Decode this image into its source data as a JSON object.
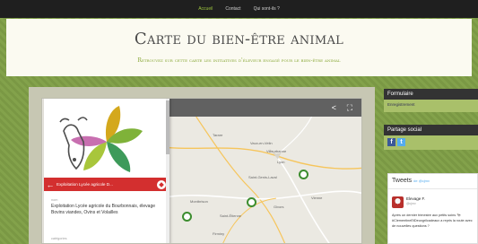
{
  "nav": {
    "items": [
      "Accueil",
      "Contact",
      "Qui sont-ils ?"
    ]
  },
  "header": {
    "title": "Carte du bien-être animal",
    "subtitle": "Retrouvez sur cette carte les initiatives d'éleveur engagé pour le bien-être animal"
  },
  "map": {
    "towns": [
      "Tarare",
      "Vaux-en-Velin",
      "Villeurbanne",
      "Lyon",
      "Saint-Genis-Laval",
      "Vienne",
      "Montbrison",
      "Saint-Étienne",
      "Givors",
      "Firminy"
    ],
    "panel": {
      "header_title": "Exploitation Lycée agricole D...",
      "field_label": "nom",
      "field_value": "Exploitation Lycée agricole du Bourbonnais, élevage Bovins viandes, Ovins et Volailles",
      "field_label_2": "catégories"
    }
  },
  "sidebar": {
    "formulaire": {
      "title": "Formulaire",
      "link": "Enregistrement"
    },
    "partage": {
      "title": "Partage social"
    },
    "tweets": {
      "title": "Tweets",
      "handle": "de @cjmv",
      "author_name": "Elevage F.",
      "author_handle": "@cjmv",
      "text": "Après un dernier trimestre aux petits soins 🐄 #ClementineEtDeuxgrilcadeaux a repris la route avec de nouvelles questions ?"
    }
  },
  "colors": {
    "accent_green": "#8aa839",
    "panel_red": "#d32f2f",
    "nav_bg": "#1f1f1f"
  }
}
